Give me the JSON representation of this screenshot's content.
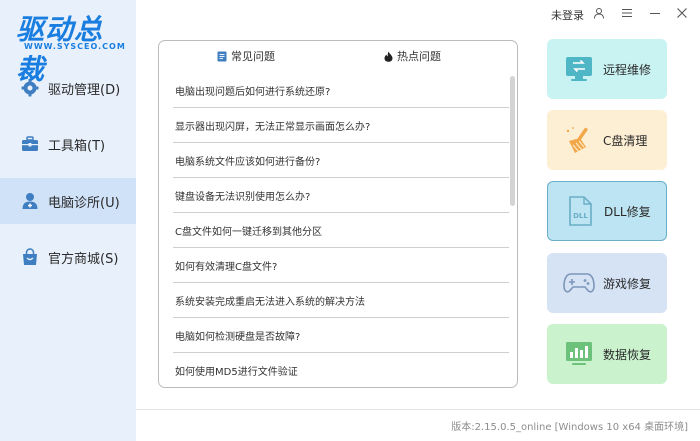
{
  "app": {
    "logo_text": "驱动总裁",
    "logo_sub": "WWW.SYSCEO.COM"
  },
  "topbar": {
    "login_label": "未登录",
    "icons": [
      "user-icon",
      "menu-icon",
      "minimize-icon",
      "close-icon"
    ]
  },
  "sidebar": {
    "items": [
      {
        "label": "驱动管理(D)",
        "icon": "gear-icon"
      },
      {
        "label": "工具箱(T)",
        "icon": "toolbox-icon"
      },
      {
        "label": "电脑诊所(U)",
        "icon": "doctor-icon"
      },
      {
        "label": "官方商城(S)",
        "icon": "shopping-bag-icon"
      }
    ]
  },
  "panel": {
    "tabs": [
      {
        "label": "常见问题",
        "icon": "document-icon"
      },
      {
        "label": "热点问题",
        "icon": "fire-icon"
      }
    ],
    "questions": [
      "电脑出现问题后如何进行系统还原?",
      "显示器出现闪屏，无法正常显示画面怎么办?",
      "电脑系统文件应该如何进行备份?",
      "键盘设备无法识别使用怎么办?",
      "C盘文件如何一键迁移到其他分区",
      "如何有效清理C盘文件?",
      "系统安装完成重启无法进入系统的解决方法",
      "电脑如何检测硬盘是否故障?",
      "如何使用MD5进行文件验证"
    ]
  },
  "cards": [
    {
      "label": "远程维修",
      "icon": "remote-repair-icon",
      "bg": "#c9f2f2",
      "accent": "#4fb6c6"
    },
    {
      "label": "C盘清理",
      "icon": "broom-icon",
      "bg": "#fdefd4",
      "accent": "#f2a84a"
    },
    {
      "label": "DLL修复",
      "icon": "dll-icon",
      "bg": "#bde4f2",
      "accent": "#6aaec7"
    },
    {
      "label": "游戏修复",
      "icon": "gamepad-icon",
      "bg": "#d5e3f5",
      "accent": "#7d96b9"
    },
    {
      "label": "数据恢复",
      "icon": "data-chart-icon",
      "bg": "#c9f2cd",
      "accent": "#6cc27a"
    }
  ],
  "footer": {
    "version": "版本:2.15.0.5_online [Windows 10 x64 桌面环境]"
  },
  "colors": {
    "sidebar_bg": "#e8f1fb",
    "sidebar_active": "#d0e2f7",
    "brand": "#1a7de0",
    "icon_blue": "#3f7ec0"
  }
}
